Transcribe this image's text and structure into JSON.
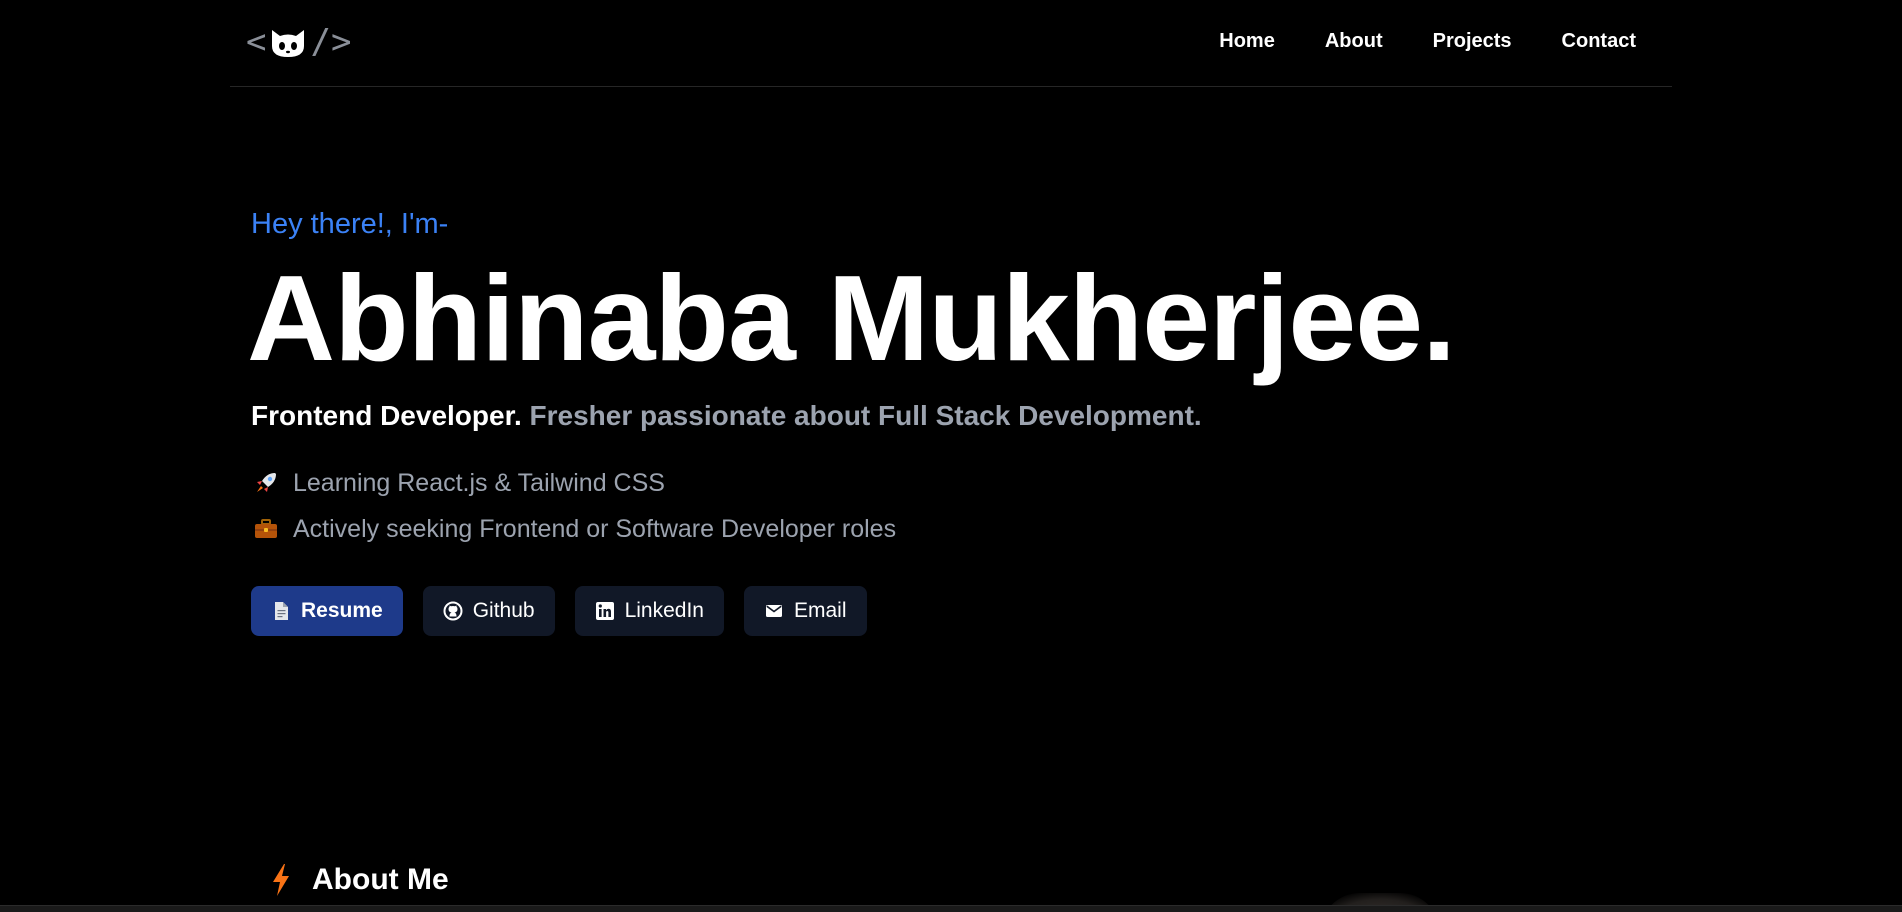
{
  "nav": {
    "logo": {
      "left": "<",
      "right": "/>",
      "icon": "cat-face-icon"
    },
    "links": [
      {
        "label": "Home"
      },
      {
        "label": "About"
      },
      {
        "label": "Projects"
      },
      {
        "label": "Contact"
      }
    ]
  },
  "hero": {
    "greeting": "Hey there!, I'm-",
    "name": "Abhinaba Mukherjee.",
    "role": "Frontend Developer.",
    "description": " Fresher passionate about Full Stack Development.",
    "bullets": [
      {
        "icon": "rocket-icon",
        "text": "Learning React.js & Tailwind CSS"
      },
      {
        "icon": "briefcase-icon",
        "text": "Actively seeking Frontend or Software Developer roles"
      }
    ],
    "buttons": [
      {
        "label": "Resume",
        "icon": "document-icon"
      },
      {
        "label": "Github",
        "icon": "github-icon"
      },
      {
        "label": "LinkedIn",
        "icon": "linkedin-icon"
      },
      {
        "label": "Email",
        "icon": "mail-icon"
      }
    ]
  },
  "about": {
    "title": "About Me",
    "icon": "lightning-bolt-icon"
  },
  "colors": {
    "background": "#000000",
    "accent_blue": "#3b82f6",
    "muted_text": "#9ca3af",
    "primary_button": "#1e3a8a",
    "secondary_button": "#111827",
    "bolt_orange": "#f97316"
  }
}
